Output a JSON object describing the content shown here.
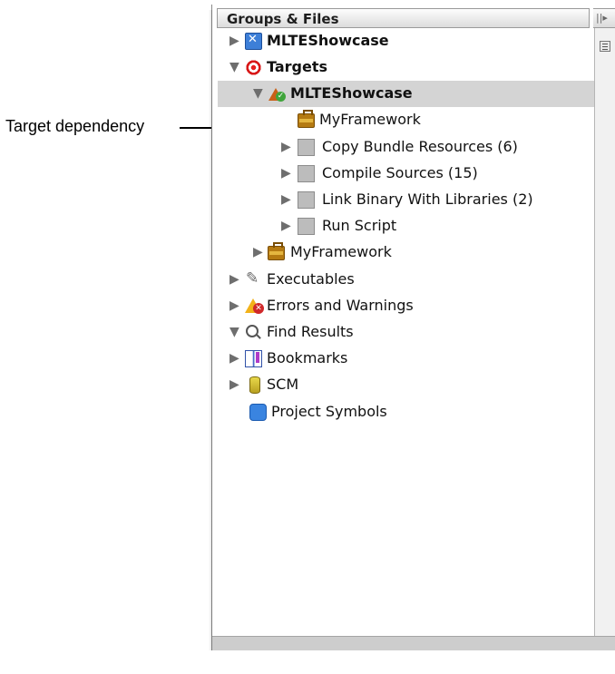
{
  "annotation": {
    "label": "Target dependency"
  },
  "panel": {
    "header_title": "Groups & Files",
    "toggle_glyph": "||▸"
  },
  "tree": {
    "items": [
      {
        "label": "MLTEShowcase",
        "icon": "xcode-project-icon",
        "disclosure": "collapsed"
      },
      {
        "label": "Targets",
        "icon": "target-icon",
        "disclosure": "expanded"
      },
      {
        "label": "MLTEShowcase",
        "icon": "application-target-icon",
        "disclosure": "expanded",
        "selected": true
      },
      {
        "label": "MyFramework",
        "icon": "framework-briefcase-icon"
      },
      {
        "label": "Copy Bundle Resources (6)",
        "icon": "build-phase-icon",
        "disclosure": "collapsed"
      },
      {
        "label": "Compile Sources (15)",
        "icon": "build-phase-icon",
        "disclosure": "collapsed"
      },
      {
        "label": "Link Binary With Libraries (2)",
        "icon": "build-phase-icon",
        "disclosure": "collapsed"
      },
      {
        "label": "Run Script",
        "icon": "build-phase-icon",
        "disclosure": "collapsed"
      },
      {
        "label": "MyFramework",
        "icon": "framework-briefcase-icon",
        "disclosure": "collapsed"
      },
      {
        "label": "Executables",
        "icon": "executable-icon",
        "disclosure": "collapsed"
      },
      {
        "label": "Errors and Warnings",
        "icon": "warning-icon",
        "disclosure": "collapsed"
      },
      {
        "label": "Find Results",
        "icon": "magnifier-icon",
        "disclosure": "expanded"
      },
      {
        "label": "Bookmarks",
        "icon": "bookmarks-icon",
        "disclosure": "collapsed"
      },
      {
        "label": "SCM",
        "icon": "scm-icon",
        "disclosure": "collapsed"
      },
      {
        "label": "Project Symbols",
        "icon": "symbols-cube-icon"
      }
    ]
  },
  "glyphs": {
    "collapsed": "▶",
    "expanded": "▼"
  }
}
